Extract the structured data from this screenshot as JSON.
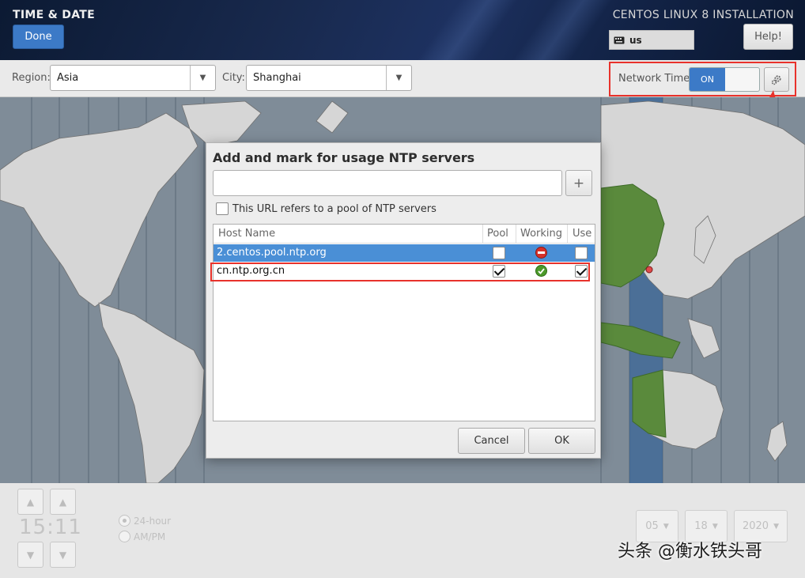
{
  "header": {
    "title": "TIME & DATE",
    "done_label": "Done",
    "install_title": "CENTOS LINUX 8 INSTALLATION",
    "keyboard_layout": "us",
    "help_label": "Help!"
  },
  "toolbar": {
    "region_label": "Region:",
    "region_value": "Asia",
    "city_label": "City:",
    "city_value": "Shanghai",
    "network_time_label": "Network Time",
    "network_time_toggle": "ON"
  },
  "dialog": {
    "title": "Add and mark for usage NTP servers",
    "server_input_value": "",
    "add_button": "+",
    "pool_checkbox_label": "This URL refers to a pool of NTP servers",
    "columns": [
      "Host Name",
      "Pool",
      "Working",
      "Use"
    ],
    "servers": [
      {
        "host": "2.centos.pool.ntp.org",
        "pool": false,
        "working": "not-working",
        "use": false
      },
      {
        "host": "cn.ntp.org.cn",
        "pool": true,
        "working": "working",
        "use": true
      }
    ],
    "cancel_label": "Cancel",
    "ok_label": "OK"
  },
  "bottom": {
    "time": "15:11",
    "format_24": "24-hour",
    "format_ampm": "AM/PM",
    "month": "05",
    "day": "18",
    "year": "2020",
    "watermark": "头条 @衡水铁头哥"
  },
  "colors": {
    "accent_blue": "#3c7ac7",
    "highlight_red": "#e8322b",
    "selected_zone_green": "#5a8a3c"
  }
}
